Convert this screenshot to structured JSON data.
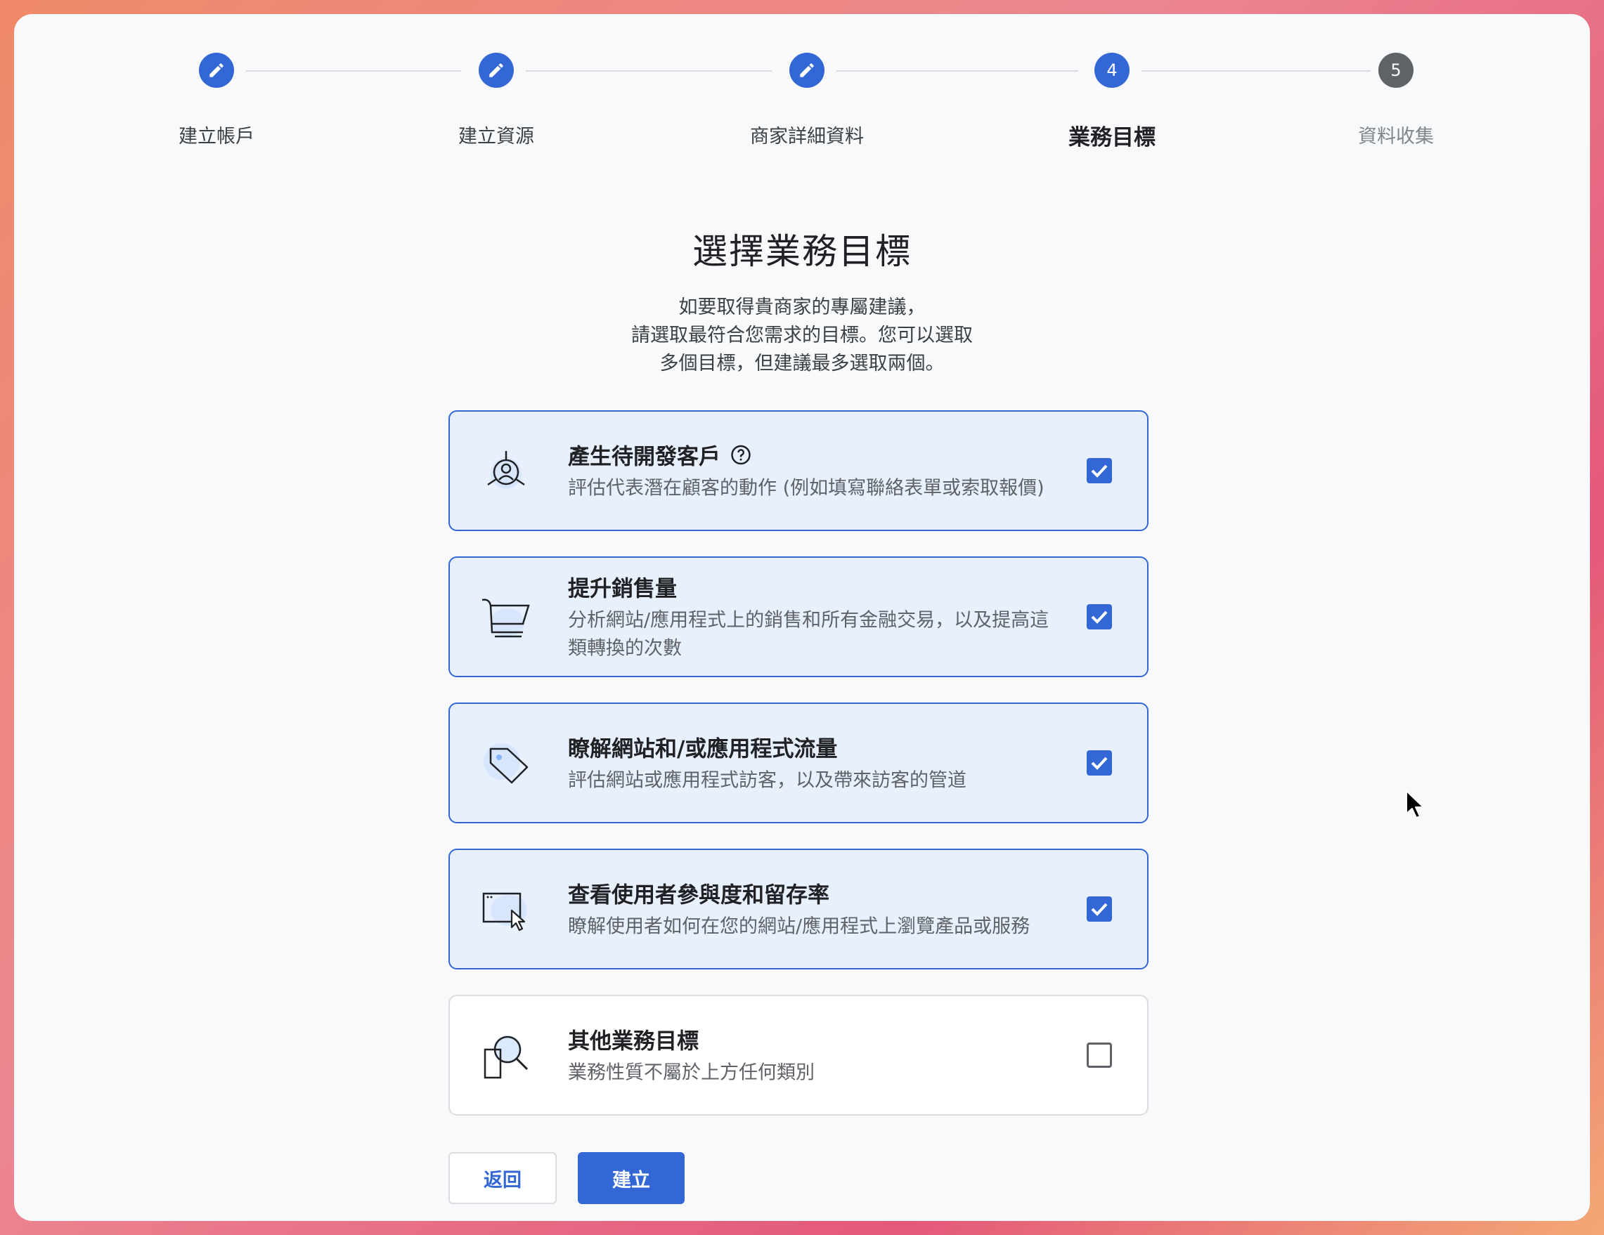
{
  "stepper": {
    "steps": [
      {
        "label": "建立帳戶",
        "state": "done",
        "icon": "pencil-icon"
      },
      {
        "label": "建立資源",
        "state": "done",
        "icon": "pencil-icon"
      },
      {
        "label": "商家詳細資料",
        "state": "done",
        "icon": "pencil-icon"
      },
      {
        "label": "業務目標",
        "state": "active",
        "number": "4"
      },
      {
        "label": "資料收集",
        "state": "pending",
        "number": "5"
      }
    ]
  },
  "page": {
    "title": "選擇業務目標",
    "description": [
      "如要取得貴商家的專屬建議，",
      "請選取最符合您需求的目標。您可以選取",
      "多個目標，但建議最多選取兩個。"
    ]
  },
  "objectives": [
    {
      "title": "產生待開發客戶",
      "subtitle": "評估代表潛在顧客的動作 (例如填寫聯絡表單或索取報價)",
      "checked": true,
      "icon": "lead-user-icon",
      "has_help": true
    },
    {
      "title": "提升銷售量",
      "subtitle": "分析網站/應用程式上的銷售和所有金融交易，以及提高這類轉換的次數",
      "checked": true,
      "icon": "shopping-cart-icon"
    },
    {
      "title": "瞭解網站和/或應用程式流量",
      "subtitle": "評估網站或應用程式訪客，以及帶來訪客的管道",
      "checked": true,
      "icon": "price-tag-icon"
    },
    {
      "title": "查看使用者參與度和留存率",
      "subtitle": "瞭解使用者如何在您的網站/應用程式上瀏覽產品或服務",
      "checked": true,
      "icon": "browser-cursor-icon"
    },
    {
      "title": "其他業務目標",
      "subtitle": "業務性質不屬於上方任何類別",
      "checked": false,
      "icon": "search-document-icon"
    }
  ],
  "buttons": {
    "back": "返回",
    "create": "建立"
  },
  "colors": {
    "accent": "#3367d6",
    "card_selected_bg": "#e8f0fe",
    "pending_step": "#5f6368"
  }
}
